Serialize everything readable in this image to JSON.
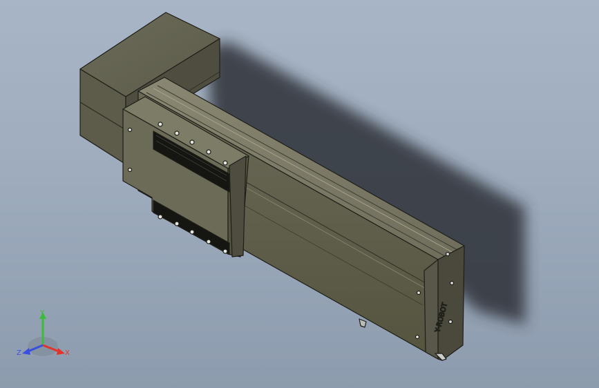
{
  "model": {
    "name": "linear-actuator-with-motor-housing",
    "brand_text": "Y-ROBOT",
    "colors": {
      "background_top": "#a8b5c6",
      "background_bottom": "#8d9bae",
      "body_dark": "#4d4c40",
      "body_mid": "#6b6a58",
      "body_light": "#8a8870",
      "edge": "#1e1e18",
      "shadow": "#3a3f47"
    }
  },
  "triad": {
    "x_label": "X",
    "y_label": "Y",
    "z_label": "Z",
    "x_color": "#e2342a",
    "y_color": "#3bbd3b",
    "z_color": "#3a4ee0"
  }
}
